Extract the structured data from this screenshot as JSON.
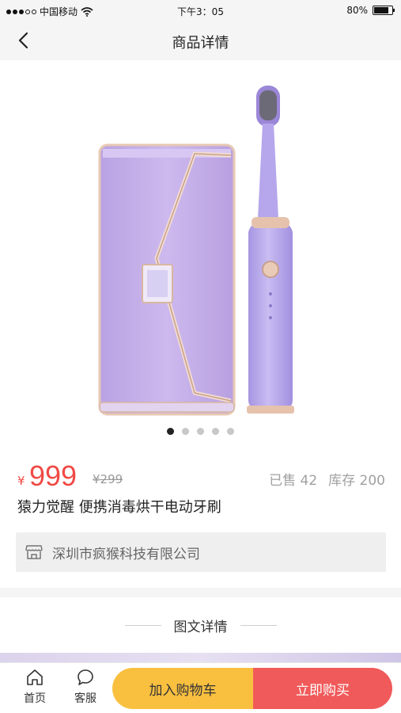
{
  "status_bar": {
    "carrier": "中国移动",
    "time": "下午3：05",
    "battery": "80%",
    "battery_level": 0.8
  },
  "nav": {
    "title": "商品详情",
    "back_icon": "chevron-left-icon"
  },
  "gallery": {
    "image_count": 5,
    "active_index": 0,
    "colors": {
      "case": "#c9b4ea",
      "brush": "#b9a6ea",
      "trim": "#d9b6a0"
    }
  },
  "product": {
    "price_symbol": "¥",
    "price": "999",
    "original_price": "¥299",
    "sold": "已售 42",
    "stock": "库存 200",
    "title": "猿力觉醒 便携消毒烘干电动牙刷"
  },
  "shop": {
    "icon": "store-icon",
    "name": "深圳市疯猴科技有限公司"
  },
  "details": {
    "title": "图文详情"
  },
  "bottom_bar": {
    "home_label": "首页",
    "service_label": "客服",
    "add_cart_label": "加入购物车",
    "buy_now_label": "立即购买",
    "colors": {
      "cart": "#f9c040",
      "buy": "#f05a5a",
      "price": "#f04a45"
    }
  }
}
